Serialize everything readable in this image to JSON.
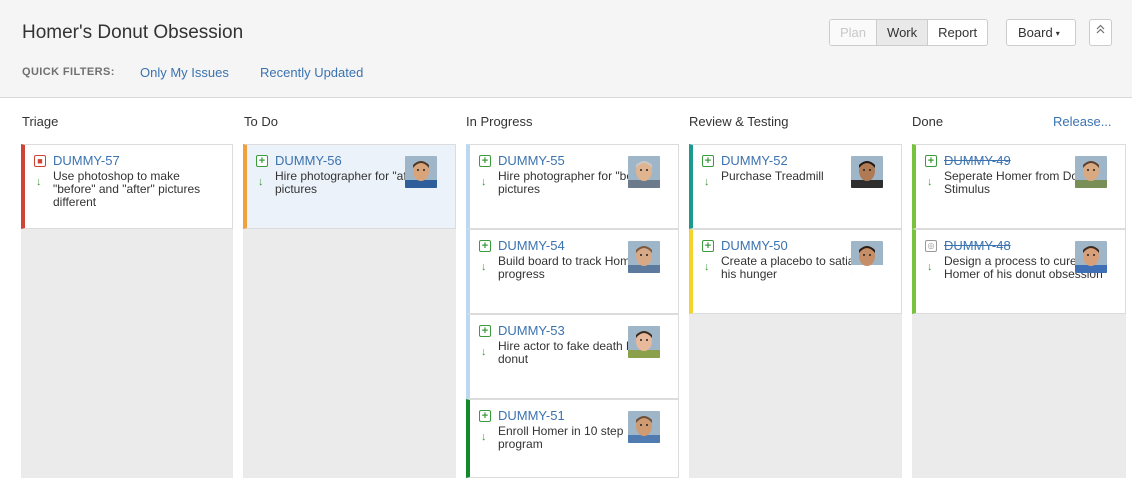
{
  "header": {
    "title": "Homer's Donut Obsession",
    "quick_filters_label": "QUICK FILTERS:",
    "quick_filters": [
      "Only My Issues",
      "Recently Updated"
    ],
    "modes": [
      "Plan",
      "Work",
      "Report"
    ],
    "active_mode": "Work",
    "board_label": "Board",
    "board_caret": "▾",
    "collapse_icon": "⌃⌃"
  },
  "columns": [
    {
      "name": "Triage"
    },
    {
      "name": "To Do"
    },
    {
      "name": "In Progress"
    },
    {
      "name": "Review & Testing"
    },
    {
      "name": "Done",
      "action": "Release..."
    }
  ],
  "cards": [
    {
      "key": "DUMMY-57",
      "summary": "Use photoshop to make \"before\" and \"after\" pictures different",
      "type": "bug",
      "priority": "low",
      "status_color": "#d04437",
      "avatar": false
    },
    {
      "key": "DUMMY-56",
      "summary": "Hire photographer for \"after\" pictures",
      "type": "story",
      "priority": "low",
      "status_color": "#f0a03c",
      "avatar": true,
      "selected": true
    },
    {
      "key": "DUMMY-55",
      "summary": "Hire photographer for \"before\" pictures",
      "type": "story",
      "priority": "low",
      "status_color": "#bcd8f0",
      "avatar": true
    },
    {
      "key": "DUMMY-54",
      "summary": "Build board to track Homer's progress",
      "type": "story",
      "priority": "low",
      "status_color": "#bcd8f0",
      "avatar": true
    },
    {
      "key": "DUMMY-53",
      "summary": "Hire actor to fake death by donut",
      "type": "story",
      "priority": "low",
      "status_color": "#bcd8f0",
      "avatar": true
    },
    {
      "key": "DUMMY-51",
      "summary": "Enroll Homer in 10 step program",
      "type": "story",
      "priority": "low",
      "status_color": "#14892c",
      "avatar": true
    },
    {
      "key": "DUMMY-52",
      "summary": "Purchase Treadmill",
      "type": "story",
      "priority": "low",
      "status_color": "#1c9a8e",
      "avatar": true
    },
    {
      "key": "DUMMY-50",
      "summary": "Create a placebo to satiate his hunger",
      "type": "story",
      "priority": "low",
      "status_color": "#f6d22c",
      "avatar": true
    },
    {
      "key": "DUMMY-49",
      "summary": "Seperate Homer from Donut Stimulus",
      "type": "story",
      "priority": "low",
      "status_color": "#79c23d",
      "avatar": true,
      "resolved": true
    },
    {
      "key": "DUMMY-48",
      "summary": "Design a process to cure Homer of his donut obsession",
      "type": "task",
      "priority": "low",
      "status_color": "#79c23d",
      "avatar": true,
      "resolved": true
    }
  ],
  "icons": {
    "story": "+",
    "bug": "■",
    "task": "◎",
    "priority_low": "↓"
  }
}
